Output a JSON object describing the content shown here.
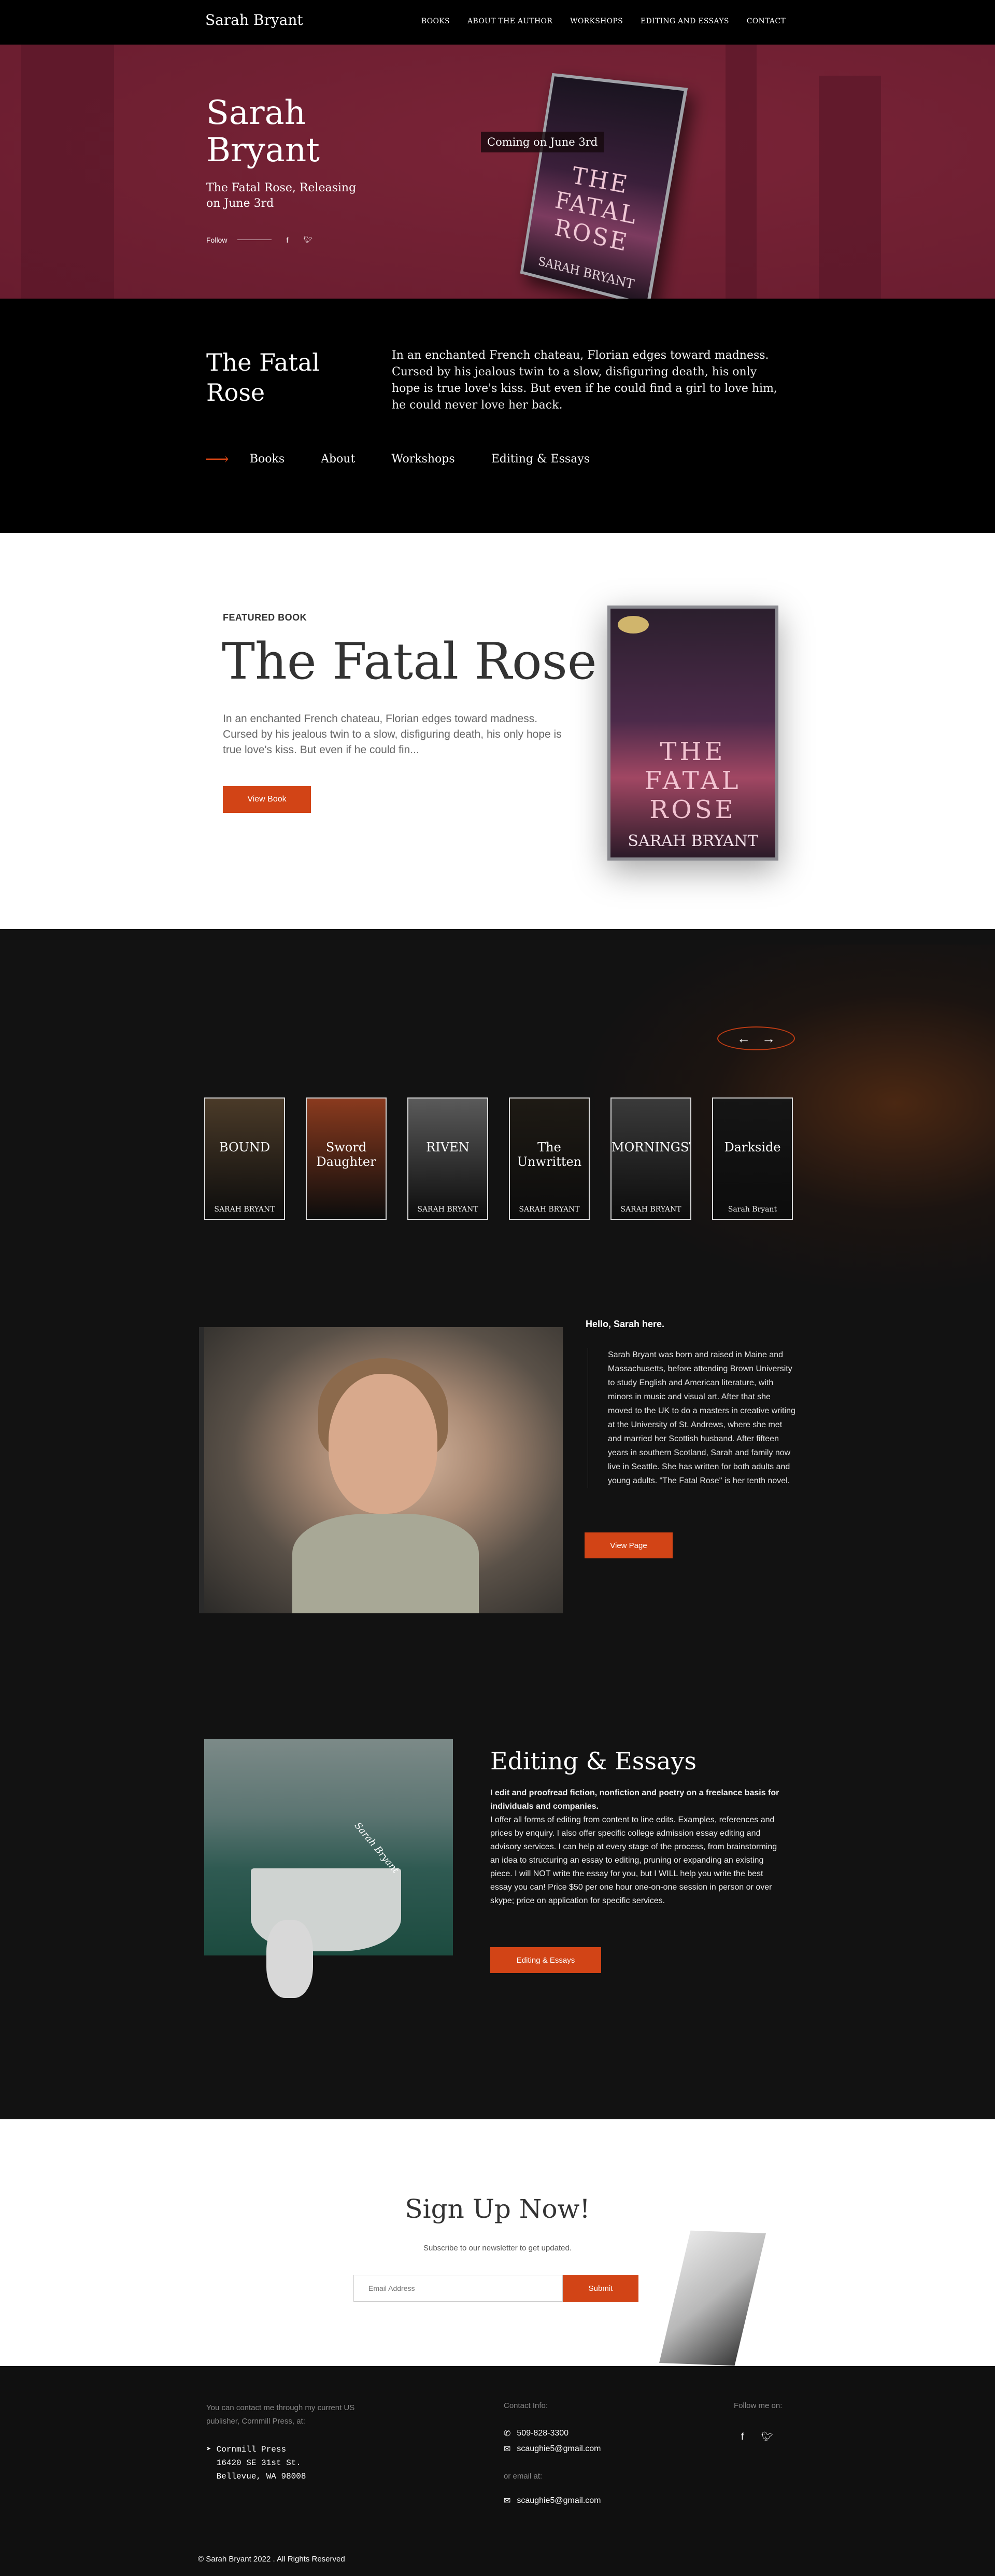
{
  "nav": {
    "site_name": "Sarah Bryant",
    "links": [
      "BOOKS",
      "ABOUT THE AUTHOR",
      "WORKSHOPS",
      "EDITING AND ESSAYS",
      "CONTACT"
    ]
  },
  "hero": {
    "title": "Sarah Bryant",
    "subtitle": "The Fatal Rose, Releasing on June 3rd",
    "follow_label": "Follow",
    "badge": "Coming on June 3rd",
    "book_title": "THE FATAL ROSE",
    "book_author": "SARAH BRYANT"
  },
  "intro": {
    "title": "The Fatal Rose",
    "description": "In an enchanted French chateau, Florian edges toward madness. Cursed by his jealous twin to a slow, disfiguring death, his only hope is true love's kiss. But even if he could find a girl to love him, he could never love her back.",
    "nav": [
      "Books",
      "About",
      "Workshops",
      "Editing & Essays"
    ]
  },
  "featured": {
    "eyebrow": "FEATURED BOOK",
    "title": "The Fatal Rose",
    "description": "In an enchanted French chateau, Florian edges toward madness. Cursed by his jealous twin to a slow, disfiguring death, his only hope is true love's kiss. But even if he could fin...",
    "button": "View Book",
    "book_title": "THE FATAL ROSE",
    "book_author": "SARAH BRYANT"
  },
  "carousel": {
    "prev": "←",
    "next": "→",
    "covers": [
      {
        "title": "BOUND",
        "author": "SARAH BRYANT",
        "bg": "#4a3a28"
      },
      {
        "title": "Sword Daughter",
        "author": "",
        "bg": "#8a3a1e"
      },
      {
        "title": "RIVEN",
        "author": "SARAH BRYANT",
        "bg": "#5a5a5a"
      },
      {
        "title": "The Unwritten",
        "author": "SARAH BRYANT",
        "bg": "#1e1a14"
      },
      {
        "title": "MORNINGSTAR",
        "author": "SARAH BRYANT",
        "bg": "#3a3a3a"
      },
      {
        "title": "Darkside",
        "author": "Sarah Bryant",
        "bg": "#151515"
      }
    ]
  },
  "about": {
    "heading": "Hello, Sarah here.",
    "text": "Sarah Bryant was born and raised in Maine and Massachusetts, before attending Brown University to study English and American literature, with minors in music and visual art. After that she moved to the UK to do a masters in creative writing at the University of St. Andrews, where she met and married her Scottish husband. After fifteen years in southern Scotland, Sarah and family now live in Seattle. She has written for both adults and young adults. \"The Fatal Rose\" is her tenth novel.",
    "button": "View Page"
  },
  "editing": {
    "title": "Editing & Essays",
    "lead": "I edit and proofread fiction, nonfiction and poetry on a freelance basis for individuals and companies.",
    "text": "I offer all forms of editing from content to line edits. Examples, references and prices by enquiry. I also offer specific college admission essay editing and advisory services. I can help at every stage of the process, from brainstorming an idea to structuring an essay to editing, pruning or expanding an existing piece. I will NOT write the essay for you, but I WILL help you write the best essay you can! Price $50 per one hour one-on-one session in person or over skype; price on application for specific services.",
    "button": "Editing & Essays",
    "image_signature": "Sarah Bryant"
  },
  "signup": {
    "title": "Sign Up Now!",
    "subtitle": "Subscribe to our newsletter to get updated.",
    "placeholder": "Email Address",
    "button": "Submit"
  },
  "footer": {
    "intro": "You can contact me through my current US publisher, Cornmill Press, at:",
    "address": [
      "Cornmill Press",
      "16420 SE 31st St.",
      "Bellevue, WA 98008"
    ],
    "contact_label": "Contact Info:",
    "phone": "509-828-3300",
    "email1": "scaughie5@gmail.com",
    "or_email": "or email at:",
    "email2": "scaughie5@gmail.com",
    "follow_label": "Follow me on:",
    "copyright": "© Sarah Bryant 2022 . All Rights Reserved"
  },
  "colors": {
    "accent": "#d24416",
    "hero_bg": "#7a2437"
  }
}
